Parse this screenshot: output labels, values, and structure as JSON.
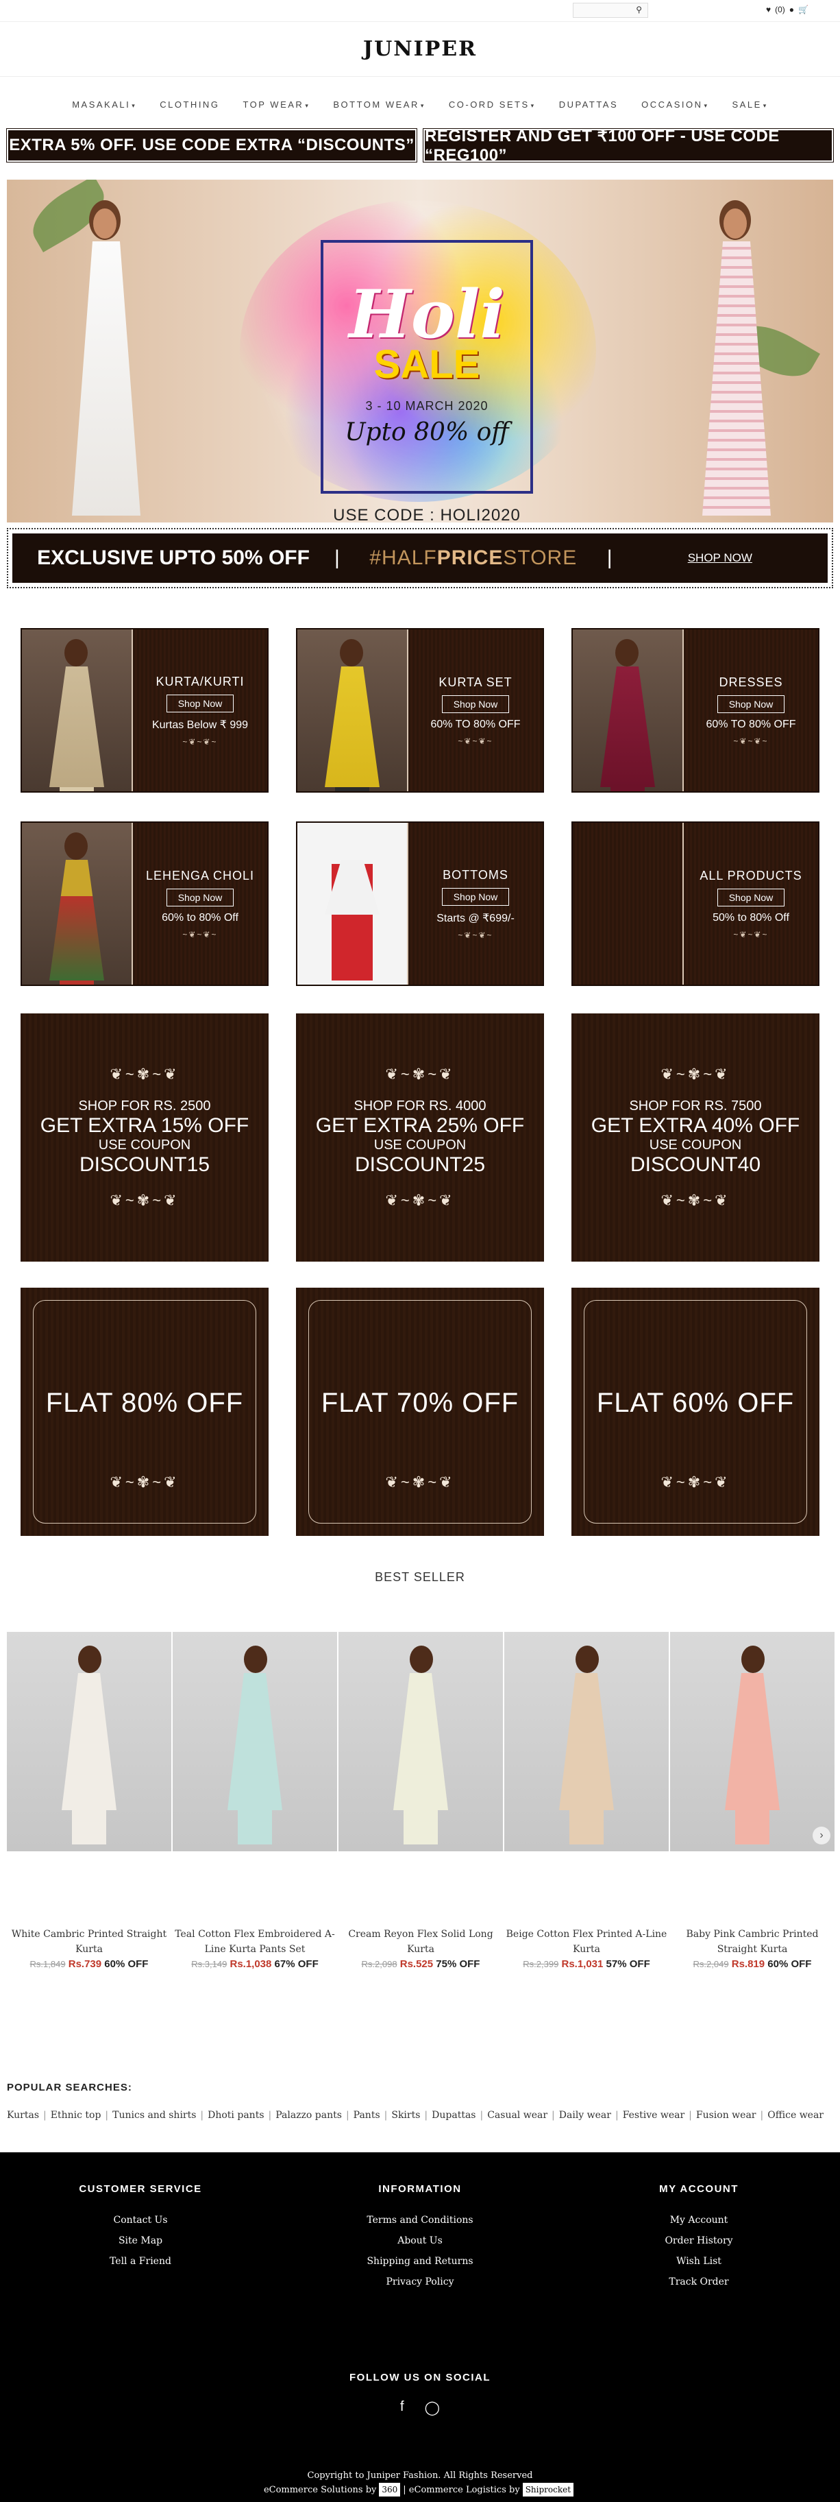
{
  "topbar": {
    "search_placeholder": "",
    "cart_count": "(0)"
  },
  "brand": {
    "logo": "JUNIPER"
  },
  "nav": [
    {
      "label": "MASAKALI",
      "caret": true
    },
    {
      "label": "CLOTHING",
      "caret": false
    },
    {
      "label": "TOP WEAR",
      "caret": true
    },
    {
      "label": "BOTTOM WEAR",
      "caret": true
    },
    {
      "label": "CO-ORD SETS",
      "caret": true
    },
    {
      "label": "DUPATTAS",
      "caret": false
    },
    {
      "label": "OCCASION",
      "caret": true
    },
    {
      "label": "SALE",
      "caret": true
    }
  ],
  "promos": [
    "EXTRA 5% OFF. USE CODE EXTRA “DISCOUNTS”",
    "REGISTER AND GET ₹100 OFF - USE CODE “REG100”"
  ],
  "hero": {
    "title": "Holi",
    "sale": "SALE",
    "dates": "3 - 10 MARCH 2020",
    "upto": "Upto 80% off",
    "code": "USE CODE : HOLI2020"
  },
  "half_banner": {
    "left": "EXCLUSIVE UPTO 50% OFF",
    "hashtag_pre": "#HALF",
    "hashtag_bold": "PRICE",
    "hashtag_post": "STORE",
    "cta": "SHOP NOW"
  },
  "categories": [
    {
      "title": "KURTA/KURTI",
      "button": "Shop Now",
      "sub": "Kurtas Below ₹ 999",
      "fig": "beige"
    },
    {
      "title": "KURTA SET",
      "button": "Shop Now",
      "sub": "60% TO 80% OFF",
      "fig": "yellow"
    },
    {
      "title": "DRESSES",
      "button": "Shop Now",
      "sub": "60% TO 80% OFF",
      "fig": "maroon"
    },
    {
      "title": "LEHENGA CHOLI",
      "button": "Shop Now",
      "sub": "60% to 80% Off",
      "fig": "lehenga"
    },
    {
      "title": "BOTTOMS",
      "button": "Shop Now",
      "sub": "Starts @ ₹699/-",
      "fig": "pants"
    },
    {
      "title": "ALL PRODUCTS",
      "button": "Shop Now",
      "sub": "50% to 80% Off",
      "fig": "none"
    }
  ],
  "coupons": [
    {
      "l1": "SHOP FOR RS. 2500",
      "l2": "GET EXTRA 15% OFF",
      "l3": "USE COUPON",
      "l4": "DISCOUNT15"
    },
    {
      "l1": "SHOP FOR RS. 4000",
      "l2": "GET EXTRA 25% OFF",
      "l3": "USE COUPON",
      "l4": "DISCOUNT25"
    },
    {
      "l1": "SHOP FOR RS. 7500",
      "l2": "GET EXTRA 40% OFF",
      "l3": "USE COUPON",
      "l4": "DISCOUNT40"
    }
  ],
  "flats": [
    "FLAT 80% OFF",
    "FLAT 70% OFF",
    "FLAT 60% OFF"
  ],
  "best_seller": {
    "title": "BEST SELLER",
    "products": [
      {
        "name": "White Cambric Printed Straight Kurta",
        "old": "Rs.1,849",
        "new": "Rs.739",
        "off": "60% OFF",
        "color": "#f1ede6"
      },
      {
        "name": "Teal Cotton Flex Embroidered A-Line Kurta Pants Set",
        "old": "Rs.3,149",
        "new": "Rs.1,038",
        "off": "67% OFF",
        "color": "#bfe1dc"
      },
      {
        "name": "Cream Reyon Flex Solid Long Kurta",
        "old": "Rs.2,098",
        "new": "Rs.525",
        "off": "75% OFF",
        "color": "#eeeedb"
      },
      {
        "name": "Beige Cotton Flex Printed A-Line Kurta",
        "old": "Rs.2,399",
        "new": "Rs.1,031",
        "off": "57% OFF",
        "color": "#e5cdb2"
      },
      {
        "name": "Baby Pink Cambric Printed Straight Kurta",
        "old": "Rs.2,049",
        "new": "Rs.819",
        "off": "60% OFF",
        "color": "#f2b3a6"
      }
    ]
  },
  "popular": {
    "title": "POPULAR SEARCHES:",
    "links": [
      "Kurtas",
      "Ethnic top",
      "Tunics and shirts",
      "Dhoti pants",
      "Palazzo pants",
      "Pants",
      "Skirts",
      "Dupattas",
      "Casual wear",
      "Daily wear",
      "Festive wear",
      "Fusion wear",
      "Office wear"
    ]
  },
  "footer": {
    "cols": [
      {
        "title": "CUSTOMER SERVICE",
        "links": [
          "Contact Us",
          "Site Map",
          "Tell a Friend"
        ]
      },
      {
        "title": "INFORMATION",
        "links": [
          "Terms and Conditions",
          "About Us",
          "Shipping and Returns",
          "Privacy Policy"
        ]
      },
      {
        "title": "MY ACCOUNT",
        "links": [
          "My Account",
          "Order History",
          "Wish List",
          "Track Order"
        ]
      }
    ],
    "follow": "FOLLOW US ON SOCIAL",
    "copyright": "Copyright to Juniper Fashion. All Rights Reserved",
    "ecom_pre": "eCommerce Solutions by",
    "ecom_badge": "360",
    "logistics_pre": "| eCommerce Logistics by",
    "logistics_badge": "Shiprocket"
  }
}
